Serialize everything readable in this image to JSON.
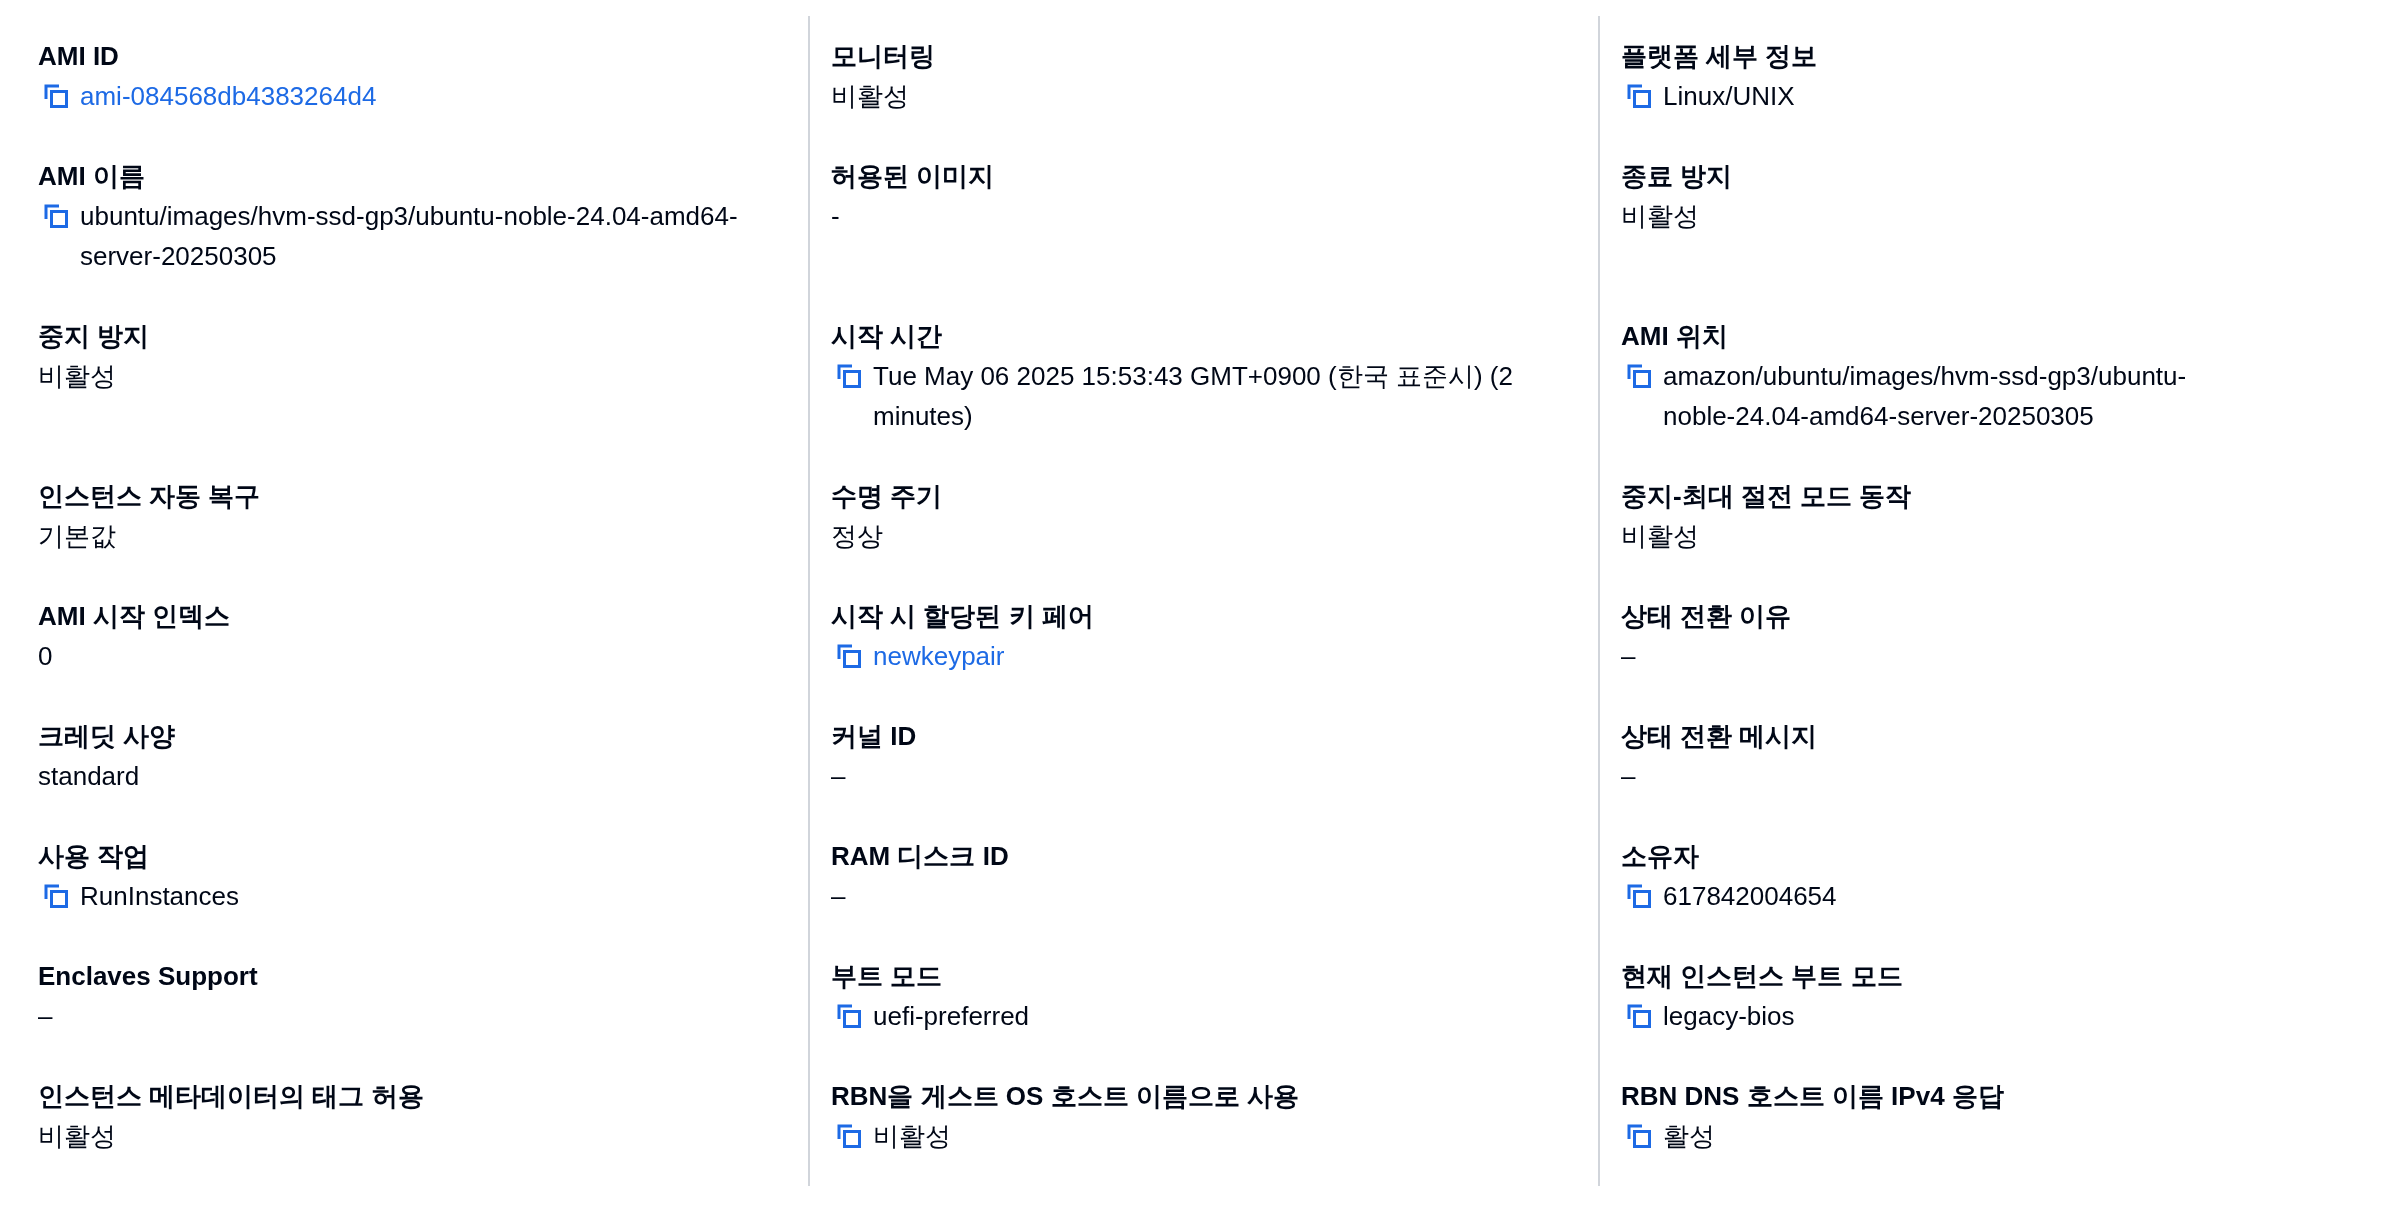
{
  "columns": [
    {
      "fields": [
        {
          "label": "AMI ID",
          "value": "ami-084568db4383264d4",
          "kind": "copy_link"
        },
        {
          "label": "AMI 이름",
          "value": "ubuntu/images/hvm-ssd-gp3/ubuntu-noble-24.04-amd64-server-20250305",
          "kind": "copy"
        },
        {
          "label": "중지 방지",
          "value": "비활성",
          "kind": "text"
        },
        {
          "label": "인스턴스 자동 복구",
          "value": "기본값",
          "kind": "text"
        },
        {
          "label": "AMI 시작 인덱스",
          "value": "0",
          "kind": "text"
        },
        {
          "label": "크레딧 사양",
          "value": "standard",
          "kind": "text"
        },
        {
          "label": "사용 작업",
          "value": "RunInstances",
          "kind": "copy"
        },
        {
          "label": "Enclaves Support",
          "value": "–",
          "kind": "text"
        },
        {
          "label": "인스턴스 메타데이터의 태그 허용",
          "value": "비활성",
          "kind": "text"
        }
      ]
    },
    {
      "fields": [
        {
          "label": "모니터링",
          "value": "비활성",
          "kind": "text"
        },
        {
          "label": "허용된 이미지",
          "value": "-",
          "kind": "text"
        },
        {
          "label": "시작 시간",
          "value": "Tue May 06 2025 15:53:43 GMT+0900 (한국 표준시) (2 minutes)",
          "kind": "copy"
        },
        {
          "label": "수명 주기",
          "value": "정상",
          "kind": "text"
        },
        {
          "label": "시작 시 할당된 키 페어",
          "value": "newkeypair",
          "kind": "copy_link"
        },
        {
          "label": "커널 ID",
          "value": "–",
          "kind": "text"
        },
        {
          "label": "RAM 디스크 ID",
          "value": "–",
          "kind": "text"
        },
        {
          "label": "부트 모드",
          "value": "uefi-preferred",
          "kind": "copy"
        },
        {
          "label": "RBN을 게스트 OS 호스트 이름으로 사용",
          "value": "비활성",
          "kind": "copy"
        }
      ]
    },
    {
      "fields": [
        {
          "label": "플랫폼 세부 정보",
          "value": "Linux/UNIX",
          "kind": "copy"
        },
        {
          "label": "종료 방지",
          "value": "비활성",
          "kind": "text"
        },
        {
          "label": "AMI 위치",
          "value": "amazon/ubuntu/images/hvm-ssd-gp3/ubuntu-noble-24.04-amd64-server-20250305",
          "kind": "copy"
        },
        {
          "label": "중지-최대 절전 모드 동작",
          "value": "비활성",
          "kind": "text"
        },
        {
          "label": "상태 전환 이유",
          "value": "–",
          "kind": "text"
        },
        {
          "label": "상태 전환 메시지",
          "value": "–",
          "kind": "text"
        },
        {
          "label": "소유자",
          "value": "617842004654",
          "kind": "copy"
        },
        {
          "label": "현재 인스턴스 부트 모드",
          "value": "legacy-bios",
          "kind": "copy"
        },
        {
          "label": "RBN DNS 호스트 이름 IPv4 응답",
          "value": "활성",
          "kind": "copy"
        }
      ]
    }
  ]
}
